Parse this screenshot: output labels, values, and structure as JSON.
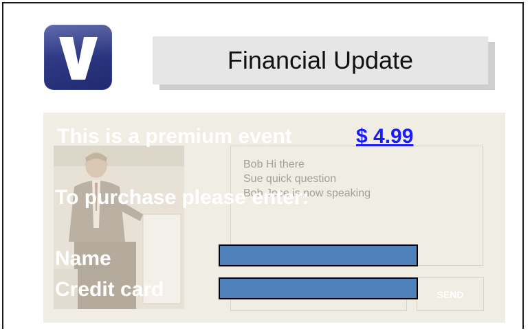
{
  "header": {
    "logo_icon": "v-logo-icon",
    "title": "Financial Update"
  },
  "video_panel": {
    "chat": {
      "messages": [
        "Bob  Hi there",
        "Sue quick question",
        "Bob Jose is now speaking"
      ],
      "send_label": "SEND"
    }
  },
  "purchase_overlay": {
    "premium_text": "This is a premium event",
    "price": "$ 4.99",
    "instruction": "To purchase please enter:",
    "name_label": "Name",
    "credit_card_label": "Credit card"
  },
  "colors": {
    "logo": "#2a3580",
    "field_fill": "#4f81bd",
    "price_link": "#1a1aff",
    "panel_bg": "#f0ede4"
  }
}
